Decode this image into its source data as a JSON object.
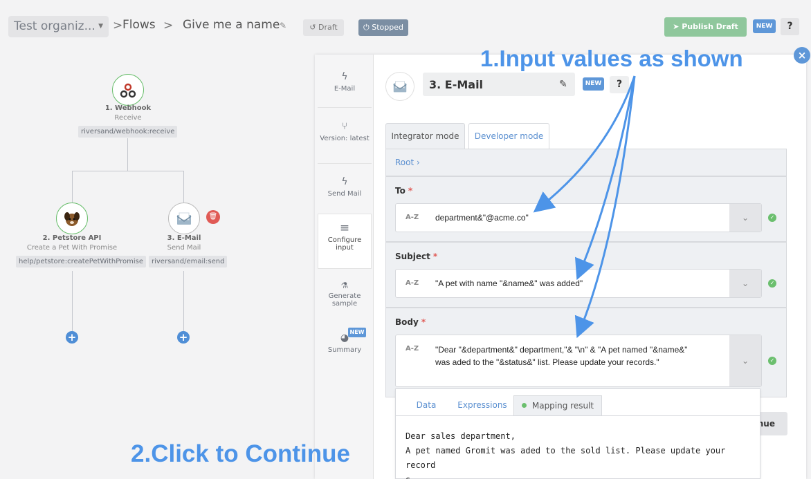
{
  "header": {
    "org": "Test organiz...",
    "flows": "Flows",
    "flow_name": "Give me a name",
    "draft": "Draft",
    "stopped": "Stopped",
    "publish": "Publish Draft",
    "new_badge": "NEW",
    "help": "?"
  },
  "nodes": {
    "webhook": {
      "title": "1. Webhook",
      "sub": "Receive",
      "tag": "riversand/webhook:receive"
    },
    "petstore": {
      "title": "2. Petstore API",
      "sub": "Create a Pet With Promise",
      "tag": "help/petstore:createPetWithPromise"
    },
    "email": {
      "title": "3. E-Mail",
      "sub": "Send Mail",
      "tag": "riversand/email:send"
    }
  },
  "sidebar": {
    "email": "E-Mail",
    "version": "Version: latest",
    "send_mail": "Send Mail",
    "configure": "Configure input",
    "generate": "Generate sample",
    "summary": "Summary",
    "new_badge": "NEW"
  },
  "step": {
    "title": "3. E-Mail",
    "new_badge": "NEW",
    "help": "?"
  },
  "tabs": {
    "integrator": "Integrator mode",
    "developer": "Developer mode"
  },
  "root": "Root",
  "fields": {
    "to": {
      "label": "To",
      "type": "A-Z",
      "value": "department&\"@acme.co\""
    },
    "subject": {
      "label": "Subject",
      "type": "A-Z",
      "value": "\"A pet with name \"&name&\" was added\""
    },
    "body": {
      "label": "Body",
      "type": "A-Z",
      "value": "\"Dear \"&department&\" department,\"& \"\\n\" & \"A pet named \"&name&\" was aded to the \"&status&\" list. Please update your records.\""
    }
  },
  "popup": {
    "tab_data": "Data",
    "tab_expr": "Expressions",
    "tab_result": "Mapping result",
    "line1": "Dear sales department,",
    "line2": "A pet named Gromit was aded to the sold list. Please update your record",
    "line3": "s."
  },
  "continue_partial": "nue",
  "annotations": {
    "top": "1.Input values as shown",
    "bottom": "2.Click to Continue"
  },
  "colors": {
    "accent": "#4d94e8",
    "success": "#6bbf6e",
    "danger": "#e05a55"
  }
}
